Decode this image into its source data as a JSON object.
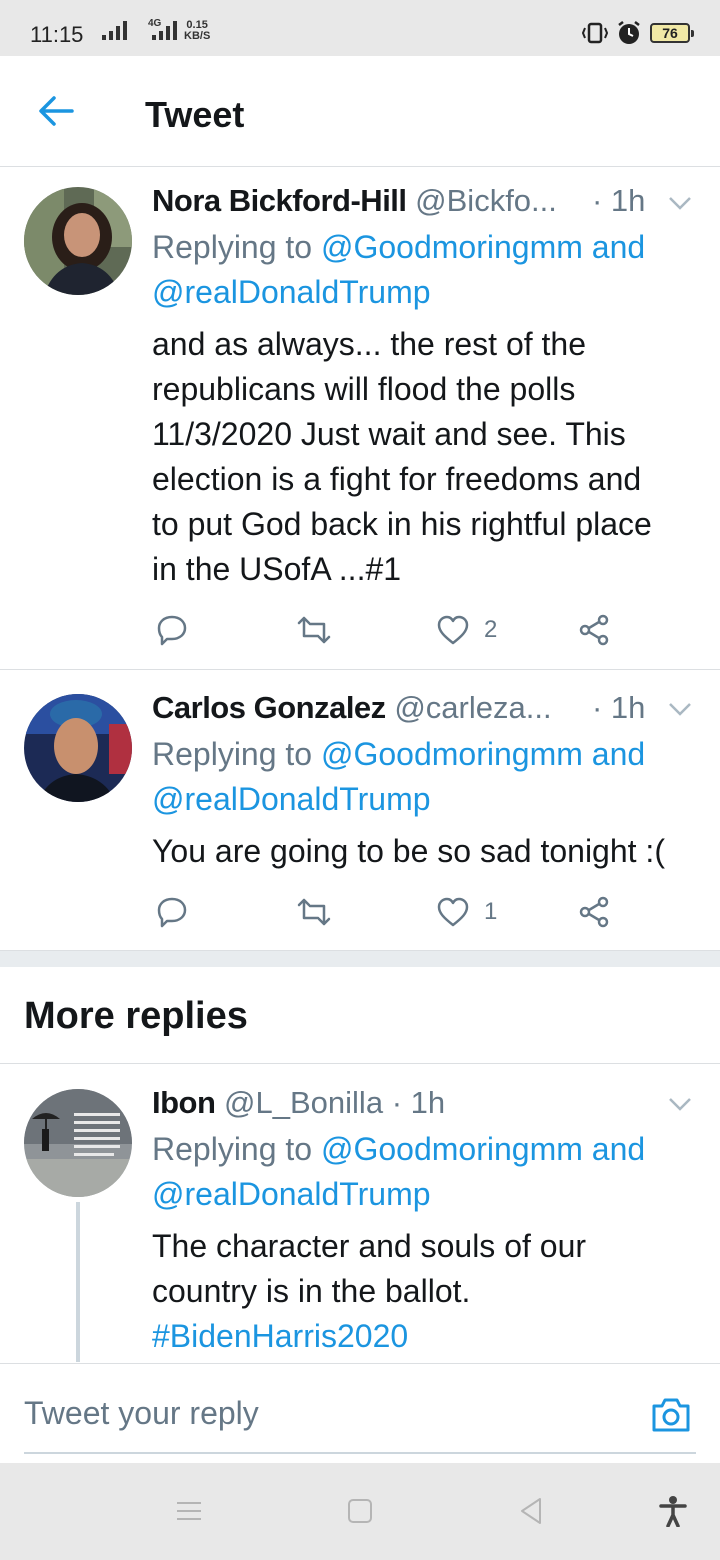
{
  "status_bar": {
    "time": "11:15",
    "network": "4G",
    "speed_value": "0.15",
    "speed_unit": "KB/S",
    "battery": "76"
  },
  "header": {
    "title": "Tweet"
  },
  "tweets": [
    {
      "name": "Nora Bickford-Hill",
      "handle": "@Bickfo...",
      "time": "· 1h",
      "replying_prefix": "Replying to",
      "mention1": "@Goodmoringmm and",
      "mention2": "@realDonaldTrump",
      "body_lines": [
        "and as always... the rest of the",
        "republicans will flood the polls",
        "11/3/2020  Just wait and see. This",
        "election is a fight for freedoms and",
        "to put God back in his rightful place",
        "in the USofA ...#1"
      ],
      "likes": "2"
    },
    {
      "name": "Carlos Gonzalez",
      "handle": "@carleza...",
      "time": "· 1h",
      "replying_prefix": "Replying to",
      "mention1": "@Goodmoringmm and",
      "mention2": "@realDonaldTrump",
      "body_lines": [
        "You are going to be so sad tonight :("
      ],
      "likes": "1"
    },
    {
      "name": "Ibon",
      "handle": "@L_Bonilla",
      "time": "· 1h",
      "replying_prefix": "Replying to",
      "mention1": "@Goodmoringmm and",
      "mention2": "@realDonaldTrump",
      "body_lines": [
        "The character and souls of our",
        "country is in the ballot."
      ],
      "hashtag": "#BidenHarris2020"
    }
  ],
  "more_replies": {
    "title": "More replies"
  },
  "composer": {
    "placeholder": "Tweet your reply"
  },
  "colors": {
    "accent": "#1b95e0",
    "secondary_text": "#657786",
    "divider": "#dcdfe2"
  },
  "icons": [
    "back-arrow-icon",
    "chevron-down-icon",
    "reply-icon",
    "retweet-icon",
    "like-icon",
    "share-icon",
    "camera-icon",
    "menu-icon",
    "home-icon",
    "back-icon",
    "accessibility-icon"
  ]
}
